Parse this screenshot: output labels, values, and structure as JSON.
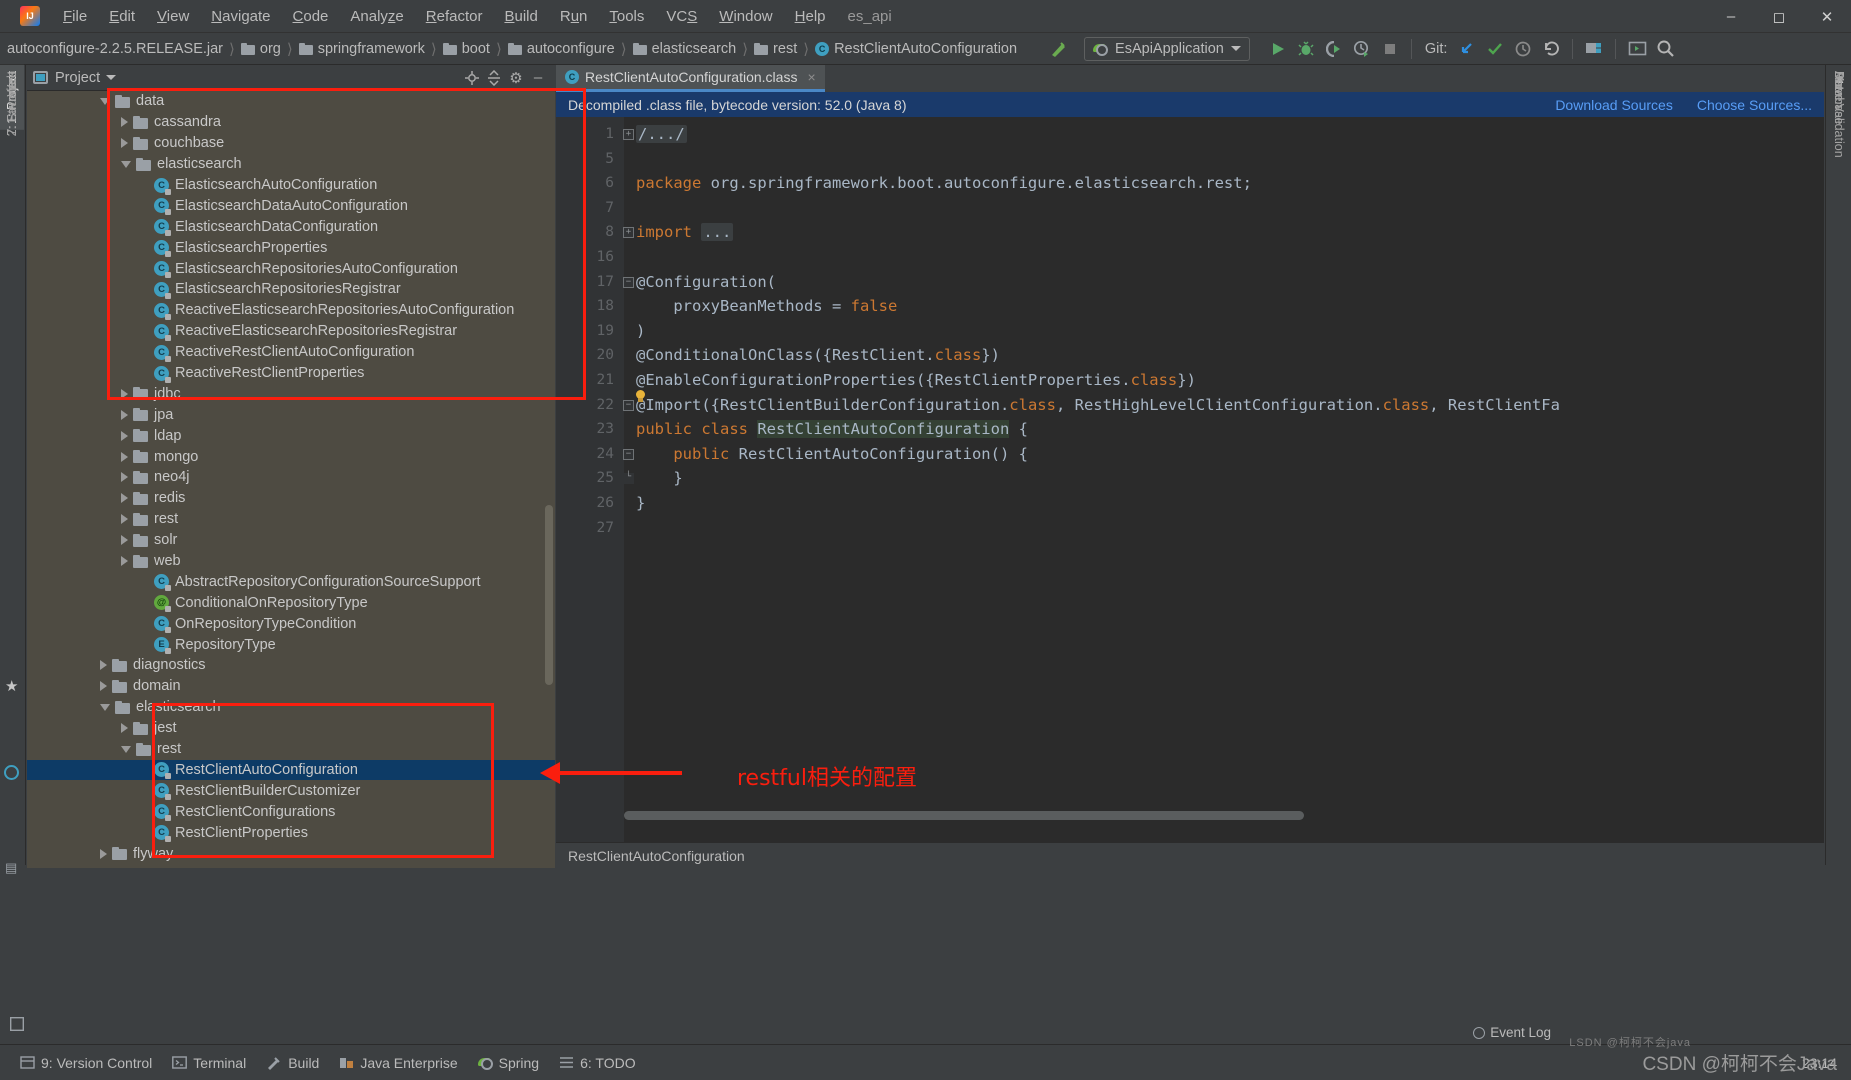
{
  "window": {
    "title_project": "es_api",
    "logo": "intellij-logo",
    "controls": [
      "minimize",
      "maximize",
      "close"
    ]
  },
  "menu": [
    {
      "label": "File",
      "mnemonic": "F"
    },
    {
      "label": "Edit",
      "mnemonic": "E"
    },
    {
      "label": "View",
      "mnemonic": "V"
    },
    {
      "label": "Navigate",
      "mnemonic": "N"
    },
    {
      "label": "Code",
      "mnemonic": "C"
    },
    {
      "label": "Analyze",
      "mnemonic": "z"
    },
    {
      "label": "Refactor",
      "mnemonic": "R"
    },
    {
      "label": "Build",
      "mnemonic": "B"
    },
    {
      "label": "Run",
      "mnemonic": "n"
    },
    {
      "label": "Tools",
      "mnemonic": "T"
    },
    {
      "label": "VCS",
      "mnemonic": "S"
    },
    {
      "label": "Window",
      "mnemonic": "W"
    },
    {
      "label": "Help",
      "mnemonic": "H"
    }
  ],
  "navbar": {
    "crumbs": [
      {
        "label": "autoconfigure-2.2.5.RELEASE.jar",
        "icon": "jar-icon"
      },
      {
        "label": "org",
        "icon": "folder-icon"
      },
      {
        "label": "springframework",
        "icon": "folder-icon"
      },
      {
        "label": "boot",
        "icon": "folder-icon"
      },
      {
        "label": "autoconfigure",
        "icon": "folder-icon"
      },
      {
        "label": "elasticsearch",
        "icon": "folder-icon"
      },
      {
        "label": "rest",
        "icon": "folder-icon"
      },
      {
        "label": "RestClientAutoConfiguration",
        "icon": "class-icon"
      }
    ],
    "run_config": "EsApiApplication",
    "git_label": "Git:",
    "toolbar_icons": [
      "run-icon",
      "debug-icon",
      "run-coverage-icon",
      "profiler-icon",
      "stop-icon",
      "git-update-icon",
      "git-commit-icon",
      "git-history-icon",
      "git-rollback-icon",
      "project-structure-icon",
      "open-terminal-icon",
      "search-everywhere-icon"
    ],
    "hammer_icon": "build-icon"
  },
  "left_strip": [
    {
      "label": "1: Project",
      "active": true
    },
    {
      "label": "2: Favorites",
      "active": false
    },
    {
      "label": "Web",
      "active": false
    },
    {
      "label": "7: Structure",
      "active": false
    }
  ],
  "right_strip": [
    {
      "label": "Ant"
    },
    {
      "label": "Database"
    },
    {
      "label": "Maven"
    },
    {
      "label": "Bean Validation"
    }
  ],
  "project_panel": {
    "title": "Project",
    "header_icons": [
      "locate-icon",
      "collapse-all-icon",
      "settings-gear-icon",
      "hide-icon"
    ],
    "tree": [
      {
        "depth": 3,
        "label": "data",
        "icon": "folder",
        "state": "expanded"
      },
      {
        "depth": 4,
        "label": "cassandra",
        "icon": "folder",
        "state": "collapsed"
      },
      {
        "depth": 4,
        "label": "couchbase",
        "icon": "folder",
        "state": "collapsed"
      },
      {
        "depth": 4,
        "label": "elasticsearch",
        "icon": "folder",
        "state": "expanded"
      },
      {
        "depth": 5,
        "label": "ElasticsearchAutoConfiguration",
        "icon": "class",
        "state": "leaf"
      },
      {
        "depth": 5,
        "label": "ElasticsearchDataAutoConfiguration",
        "icon": "class",
        "state": "leaf"
      },
      {
        "depth": 5,
        "label": "ElasticsearchDataConfiguration",
        "icon": "abstract-class",
        "state": "leaf"
      },
      {
        "depth": 5,
        "label": "ElasticsearchProperties",
        "icon": "class",
        "state": "leaf"
      },
      {
        "depth": 5,
        "label": "ElasticsearchRepositoriesAutoConfiguration",
        "icon": "class",
        "state": "leaf"
      },
      {
        "depth": 5,
        "label": "ElasticsearchRepositoriesRegistrar",
        "icon": "class",
        "state": "leaf"
      },
      {
        "depth": 5,
        "label": "ReactiveElasticsearchRepositoriesAutoConfiguration",
        "icon": "class",
        "state": "leaf"
      },
      {
        "depth": 5,
        "label": "ReactiveElasticsearchRepositoriesRegistrar",
        "icon": "class",
        "state": "leaf"
      },
      {
        "depth": 5,
        "label": "ReactiveRestClientAutoConfiguration",
        "icon": "class",
        "state": "leaf"
      },
      {
        "depth": 5,
        "label": "ReactiveRestClientProperties",
        "icon": "class",
        "state": "leaf"
      },
      {
        "depth": 4,
        "label": "jdbc",
        "icon": "folder",
        "state": "collapsed"
      },
      {
        "depth": 4,
        "label": "jpa",
        "icon": "folder",
        "state": "collapsed"
      },
      {
        "depth": 4,
        "label": "ldap",
        "icon": "folder",
        "state": "collapsed"
      },
      {
        "depth": 4,
        "label": "mongo",
        "icon": "folder",
        "state": "collapsed"
      },
      {
        "depth": 4,
        "label": "neo4j",
        "icon": "folder",
        "state": "collapsed"
      },
      {
        "depth": 4,
        "label": "redis",
        "icon": "folder",
        "state": "collapsed"
      },
      {
        "depth": 4,
        "label": "rest",
        "icon": "folder",
        "state": "collapsed"
      },
      {
        "depth": 4,
        "label": "solr",
        "icon": "folder",
        "state": "collapsed"
      },
      {
        "depth": 4,
        "label": "web",
        "icon": "folder",
        "state": "collapsed"
      },
      {
        "depth": 5,
        "label": "AbstractRepositoryConfigurationSourceSupport",
        "icon": "abstract-class",
        "state": "leaf"
      },
      {
        "depth": 5,
        "label": "ConditionalOnRepositoryType",
        "icon": "annotation",
        "state": "leaf"
      },
      {
        "depth": 5,
        "label": "OnRepositoryTypeCondition",
        "icon": "class",
        "state": "leaf"
      },
      {
        "depth": 5,
        "label": "RepositoryType",
        "icon": "enum",
        "state": "leaf"
      },
      {
        "depth": 3,
        "label": "diagnostics",
        "icon": "folder",
        "state": "collapsed"
      },
      {
        "depth": 3,
        "label": "domain",
        "icon": "folder",
        "state": "collapsed"
      },
      {
        "depth": 3,
        "label": "elasticsearch",
        "icon": "folder",
        "state": "expanded"
      },
      {
        "depth": 4,
        "label": "jest",
        "icon": "folder",
        "state": "collapsed"
      },
      {
        "depth": 4,
        "label": "rest",
        "icon": "folder",
        "state": "expanded"
      },
      {
        "depth": 5,
        "label": "RestClientAutoConfiguration",
        "icon": "class",
        "state": "leaf",
        "selected": true
      },
      {
        "depth": 5,
        "label": "RestClientBuilderCustomizer",
        "icon": "class",
        "state": "leaf"
      },
      {
        "depth": 5,
        "label": "RestClientConfigurations",
        "icon": "class",
        "state": "leaf"
      },
      {
        "depth": 5,
        "label": "RestClientProperties",
        "icon": "class",
        "state": "leaf"
      },
      {
        "depth": 3,
        "label": "flyway",
        "icon": "folder",
        "state": "collapsed"
      }
    ]
  },
  "editor": {
    "tab": {
      "label": "RestClientAutoConfiguration.class",
      "icon": "class-icon",
      "close": "×"
    },
    "decompile_notice": "Decompiled .class file, bytecode version: 52.0 (Java 8)",
    "download_sources": "Download Sources",
    "choose_sources": "Choose Sources...",
    "line_numbers": [
      "1",
      "5",
      "6",
      "7",
      "8",
      "16",
      "17",
      "18",
      "19",
      "20",
      "21",
      "22",
      "23",
      "24",
      "25",
      "26",
      "27"
    ],
    "lines": [
      {
        "num": "1",
        "fold": "plus",
        "segments": [
          {
            "t": "/.../",
            "c": "foldbox"
          }
        ]
      },
      {
        "num": "5",
        "fold": "",
        "segments": []
      },
      {
        "num": "6",
        "fold": "",
        "segments": [
          {
            "t": "package ",
            "c": "kw"
          },
          {
            "t": "org.springframework.boot.autoconfigure.elasticsearch.rest;",
            "c": ""
          }
        ]
      },
      {
        "num": "7",
        "fold": "",
        "segments": []
      },
      {
        "num": "8",
        "fold": "plus",
        "segments": [
          {
            "t": "import ",
            "c": "kw"
          },
          {
            "t": "...",
            "c": "foldbox"
          }
        ]
      },
      {
        "num": "16",
        "fold": "",
        "segments": []
      },
      {
        "num": "17",
        "fold": "minus",
        "segments": [
          {
            "t": "@Configuration(",
            "c": ""
          }
        ]
      },
      {
        "num": "18",
        "fold": "",
        "segments": [
          {
            "t": "    proxyBeanMethods = ",
            "c": ""
          },
          {
            "t": "false",
            "c": "kw"
          }
        ]
      },
      {
        "num": "19",
        "fold": "",
        "segments": [
          {
            "t": ")",
            "c": ""
          }
        ]
      },
      {
        "num": "20",
        "fold": "",
        "segments": [
          {
            "t": "@ConditionalOnClass({RestClient.",
            "c": ""
          },
          {
            "t": "class",
            "c": "kw"
          },
          {
            "t": "})",
            "c": ""
          }
        ]
      },
      {
        "num": "21",
        "fold": "",
        "segments": [
          {
            "t": "@EnableConfigurationProperties({RestClientProperties.",
            "c": ""
          },
          {
            "t": "class",
            "c": "kw"
          },
          {
            "t": "})",
            "c": ""
          }
        ]
      },
      {
        "num": "22",
        "fold": "minus",
        "segments": [
          {
            "t": "@Import({RestClientBuilderConfiguration.",
            "c": ""
          },
          {
            "t": "class",
            "c": "kw"
          },
          {
            "t": ", RestHighLevelClientConfiguration.",
            "c": ""
          },
          {
            "t": "class",
            "c": "kw"
          },
          {
            "t": ", RestClientFa",
            "c": ""
          }
        ]
      },
      {
        "num": "23",
        "fold": "",
        "segments": [
          {
            "t": "public class ",
            "c": "kw"
          },
          {
            "t": "RestClientAutoConfiguration",
            "c": "clshl"
          },
          {
            "t": " {",
            "c": ""
          }
        ]
      },
      {
        "num": "24",
        "fold": "minus",
        "segments": [
          {
            "t": "    public ",
            "c": "kw"
          },
          {
            "t": "RestClientAutoConfiguration() {",
            "c": ""
          }
        ]
      },
      {
        "num": "25",
        "fold": "end",
        "segments": [
          {
            "t": "    }",
            "c": ""
          }
        ]
      },
      {
        "num": "26",
        "fold": "",
        "segments": [
          {
            "t": "}",
            "c": ""
          }
        ]
      },
      {
        "num": "27",
        "fold": "",
        "segments": []
      }
    ],
    "status_path": "RestClientAutoConfiguration"
  },
  "statusbar": {
    "items": [
      {
        "label": "9: Version Control",
        "icon": "version-control-icon"
      },
      {
        "label": "Terminal",
        "icon": "terminal-icon"
      },
      {
        "label": "Build",
        "icon": "build-hammer-icon"
      },
      {
        "label": "Java Enterprise",
        "icon": "java-enterprise-icon"
      },
      {
        "label": "Spring",
        "icon": "spring-leaf-icon"
      },
      {
        "label": "6: TODO",
        "icon": "todo-icon"
      }
    ],
    "time": "23:14",
    "event_log": "Event Log"
  },
  "annotations": {
    "note": "restful相关的配置",
    "watermark": "CSDN @柯柯不会Java",
    "watermark_sub": "LSDN @柯柯不会java",
    "accent_red": "#fa1e0e"
  }
}
